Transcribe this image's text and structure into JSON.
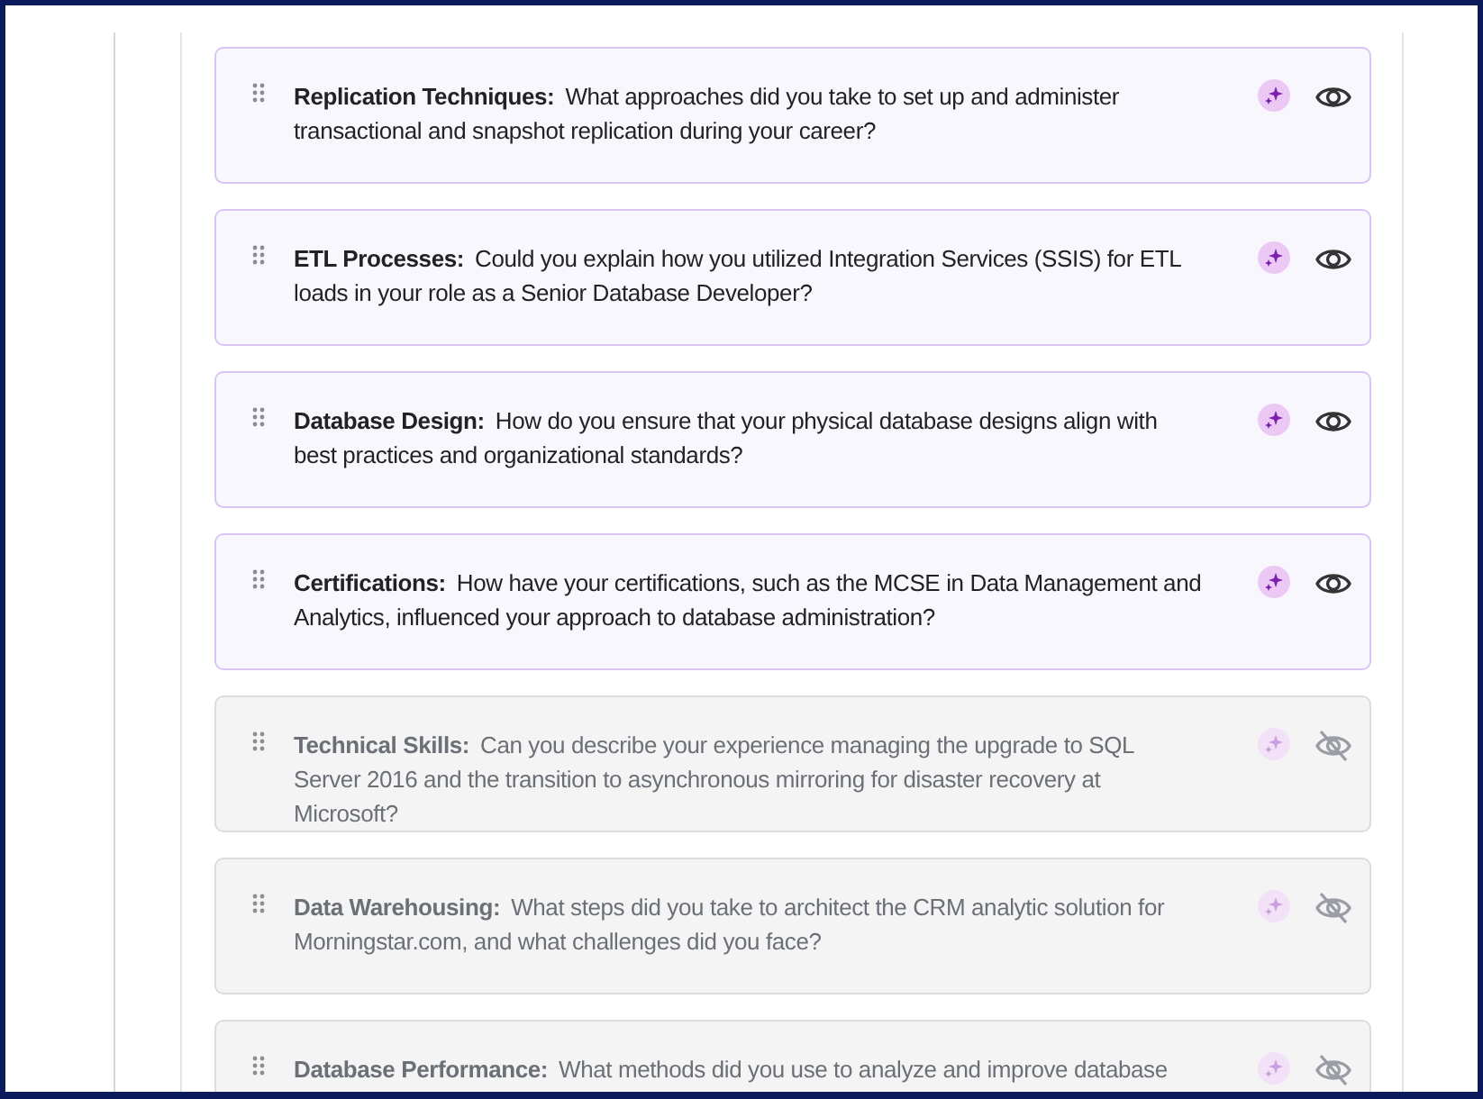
{
  "questions": [
    {
      "topic": "Replication Techniques:",
      "question": "What approaches did you take to set up and administer transactional and snapshot replication during your career?",
      "visible": true
    },
    {
      "topic": "ETL Processes:",
      "question": "Could you explain how you utilized Integration Services (SSIS) for ETL loads in your role as a Senior Database Developer?",
      "visible": true
    },
    {
      "topic": "Database Design:",
      "question": "How do you ensure that your physical database designs align with best practices and organizational standards?",
      "visible": true
    },
    {
      "topic": "Certifications:",
      "question": "How have your certifications, such as the MCSE in Data Management and Analytics, influenced your approach to database administration?",
      "visible": true
    },
    {
      "topic": "Technical Skills:",
      "question": "Can you describe your experience managing the upgrade to SQL Server 2016 and the transition to asynchronous mirroring for disaster recovery at Microsoft?",
      "visible": false
    },
    {
      "topic": "Data Warehousing:",
      "question": "What steps did you take to architect the CRM analytic solution for Morningstar.com, and what challenges did you face?",
      "visible": false
    },
    {
      "topic": "Database Performance:",
      "question": "What methods did you use to analyze and improve database",
      "visible": false
    }
  ]
}
